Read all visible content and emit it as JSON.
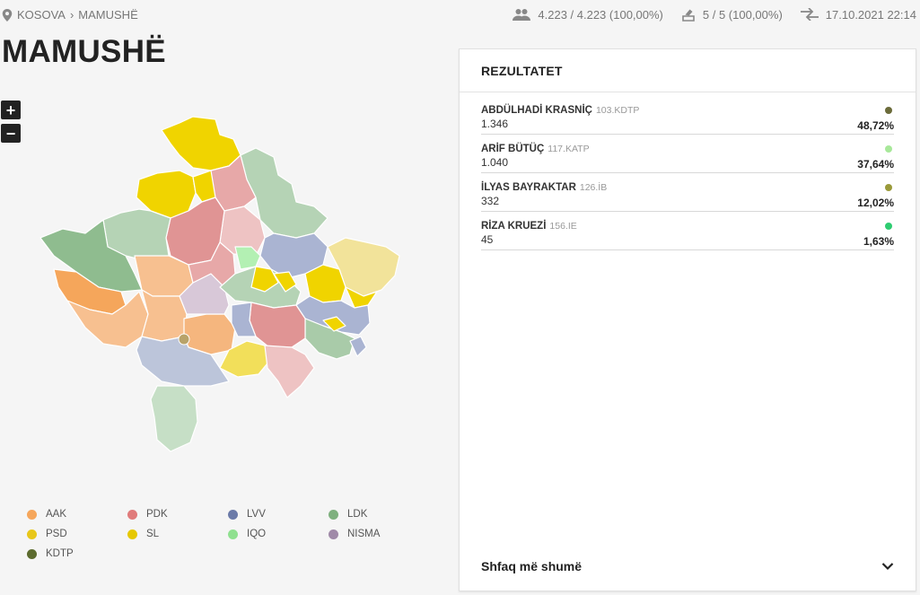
{
  "breadcrumb": {
    "root": "KOSOVA",
    "current": "MAMUSHË"
  },
  "stats": {
    "voters": "4.223 / 4.223 (100,00%)",
    "stations": "5 / 5 (100,00%)",
    "updated": "17.10.2021 22:14"
  },
  "title": "MAMUSHË",
  "zoom": {
    "in": "+",
    "out": "−"
  },
  "legend": [
    {
      "label": "AAK",
      "color": "#f5a65b"
    },
    {
      "label": "PDK",
      "color": "#e07b7b"
    },
    {
      "label": "LVV",
      "color": "#6b7aa8"
    },
    {
      "label": "LDK",
      "color": "#7fb07f"
    },
    {
      "label": "PSD",
      "color": "#e8c71a"
    },
    {
      "label": "SL",
      "color": "#e6c800"
    },
    {
      "label": "IQO",
      "color": "#8fe08f"
    },
    {
      "label": "NISMA",
      "color": "#a08aa8"
    },
    {
      "label": "KDTP",
      "color": "#5c6b2e"
    }
  ],
  "results": {
    "header": "REZULTATET",
    "rows": [
      {
        "name": "ABDÜLHADİ KRASNİÇ",
        "code": "103.KDTP",
        "votes": "1.346",
        "pct": "48,72%",
        "color": "#6b6b3a"
      },
      {
        "name": "ARİF BÜTÜÇ",
        "code": "117.KATP",
        "votes": "1.040",
        "pct": "37,64%",
        "color": "#a8e89a"
      },
      {
        "name": "İLYAS BAYRAKTAR",
        "code": "126.İB",
        "votes": "332",
        "pct": "12,02%",
        "color": "#9a9a3a"
      },
      {
        "name": "RİZA KRUEZİ",
        "code": "156.IE",
        "votes": "45",
        "pct": "1,63%",
        "color": "#2ecc71"
      }
    ],
    "show_more": "Shfaq më shumë"
  }
}
